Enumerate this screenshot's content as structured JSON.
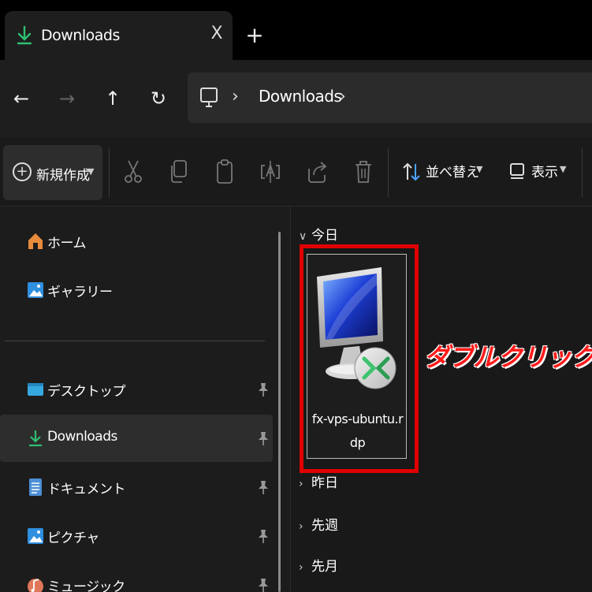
{
  "tab": {
    "title": "Downloads",
    "close": "X",
    "new_tab": "+"
  },
  "nav": {
    "back": "←",
    "forward": "→",
    "up": "↑",
    "refresh": "↻",
    "breadcrumb_sep": "›",
    "breadcrumb": "Downloads"
  },
  "toolbar": {
    "new_label": "新規作成",
    "sort_label": "並べ替え",
    "view_label": "表示",
    "chevron": "⌄"
  },
  "sidebar": {
    "items": [
      {
        "label": "ホーム",
        "icon": "home-icon"
      },
      {
        "label": "ギャラリー",
        "icon": "gallery-icon"
      },
      {
        "label": "デスクトップ",
        "icon": "desktop-folder-icon",
        "pinned": true
      },
      {
        "label": "Downloads",
        "icon": "downloads-icon",
        "pinned": true,
        "active": true
      },
      {
        "label": "ドキュメント",
        "icon": "documents-icon",
        "pinned": true
      },
      {
        "label": "ピクチャ",
        "icon": "pictures-icon",
        "pinned": true
      },
      {
        "label": "ミュージック",
        "icon": "music-icon",
        "pinned": true
      }
    ]
  },
  "main": {
    "groups": {
      "today": "今日",
      "yesterday": "昨日",
      "last_week": "先週",
      "last_month": "先月"
    },
    "file": {
      "name": "fx-vps-ubuntu.rdp",
      "icon": "remote-desktop-icon"
    },
    "annotation": "ダブルクリック"
  },
  "colors": {
    "accent_green": "#2fbf71",
    "highlight_red": "#e00000",
    "annotation_red": "#ff1a1a"
  }
}
